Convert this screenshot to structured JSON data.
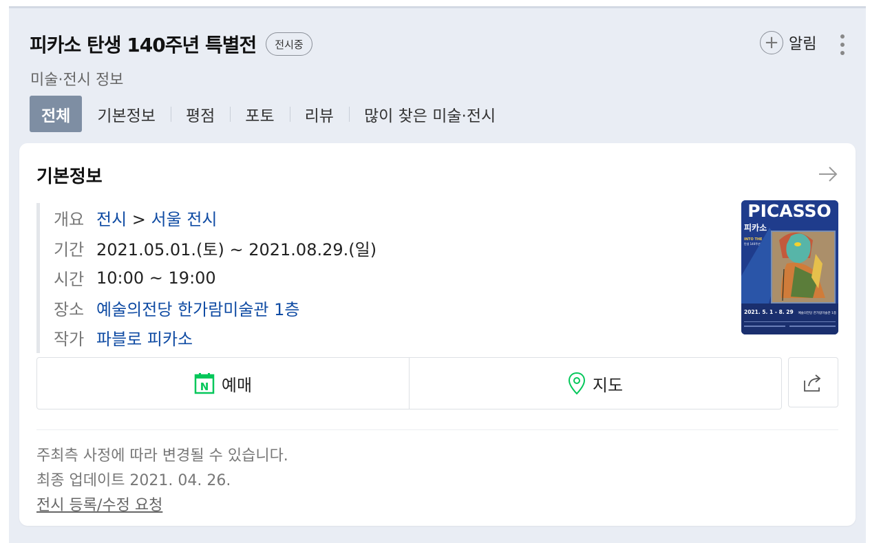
{
  "header": {
    "title": "피카소 탄생 140주년 특별전",
    "badge": "전시중",
    "alarm_label": "알림",
    "subtitle": "미술·전시 정보"
  },
  "tabs": [
    {
      "label": "전체",
      "active": true
    },
    {
      "label": "기본정보"
    },
    {
      "label": "평점"
    },
    {
      "label": "포토"
    },
    {
      "label": "리뷰"
    },
    {
      "label": "많이 찾은 미술·전시"
    }
  ],
  "card": {
    "title": "기본정보",
    "rows": [
      {
        "key": "개요",
        "value_link1": "전시",
        "value_sep": " > ",
        "value_link2": "서울 전시"
      },
      {
        "key": "기간",
        "value": "2021.05.01.(토) ~ 2021.08.29.(일)"
      },
      {
        "key": "시간",
        "value": "10:00 ~ 19:00"
      },
      {
        "key": "장소",
        "value": "예술의전당 한가람미술관 1층"
      },
      {
        "key": "작가",
        "value": "파블로 피카소"
      }
    ],
    "poster": {
      "title": "PICASSO",
      "subtitle": "피카소",
      "tag": "INTO THE MYTH",
      "tag2": "탄생 140주년 특별전",
      "dates": "2021. 5. 1 - 8. 29",
      "venue": "예술의전당 한가람미술관 1층"
    },
    "buttons": {
      "reserve": "예매",
      "map": "지도",
      "naver_glyph": "N"
    },
    "notes": {
      "line1": "주최측 사정에 따라 변경될 수 있습니다.",
      "line2": "최종 업데이트 2021. 04. 26.",
      "request": "전시 등록/수정 요청"
    }
  },
  "colors": {
    "accent_link": "#0f4ba3",
    "tab_active_bg": "#7e8ea3",
    "naver_green": "#03c75a",
    "panel_bg": "#e9edf4",
    "poster_bg": "#1f3c8c"
  },
  "icons": [
    "plus-icon",
    "more-vertical-icon",
    "arrow-right-icon",
    "naver-calendar-icon",
    "map-pin-icon",
    "share-icon"
  ]
}
